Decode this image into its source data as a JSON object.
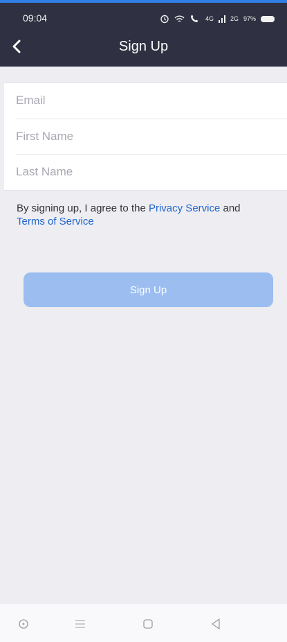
{
  "status_bar": {
    "time": "09:04",
    "signal_4g": "4G",
    "signal_2g": "2G",
    "battery": "97%"
  },
  "header": {
    "title": "Sign Up"
  },
  "form": {
    "email_placeholder": "Email",
    "first_name_placeholder": "First Name",
    "last_name_placeholder": "Last Name"
  },
  "terms": {
    "prefix": "By signing up, I agree to the ",
    "privacy_link": "Privacy Service",
    "conjunction": " and",
    "terms_link": "Terms of Service"
  },
  "actions": {
    "signup_label": "Sign Up"
  },
  "colors": {
    "header_bg": "#2f3041",
    "link": "#2166cc",
    "button_disabled": "#9bbdf0",
    "page_bg": "#ededf2"
  }
}
